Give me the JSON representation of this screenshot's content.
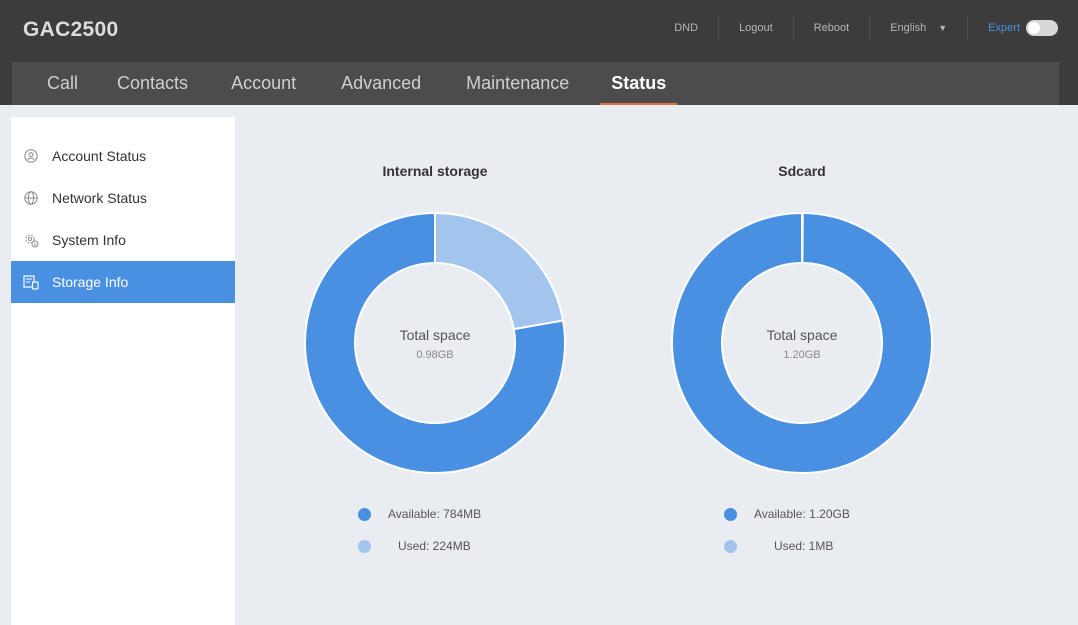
{
  "app": {
    "title": "GAC2500"
  },
  "header": {
    "links": [
      "DND",
      "Logout",
      "Reboot"
    ],
    "language": "English",
    "expert_label": "Expert"
  },
  "nav": {
    "tabs": [
      {
        "label": "Call"
      },
      {
        "label": "Contacts"
      },
      {
        "label": "Account"
      },
      {
        "label": "Advanced"
      },
      {
        "label": "Maintenance"
      },
      {
        "label": "Status",
        "active": true
      }
    ]
  },
  "sidebar": {
    "items": [
      {
        "label": "Account Status",
        "icon": "user-circle-icon"
      },
      {
        "label": "Network Status",
        "icon": "globe-icon"
      },
      {
        "label": "System Info",
        "icon": "gear-info-icon"
      },
      {
        "label": "Storage Info",
        "icon": "storage-icon",
        "active": true
      }
    ]
  },
  "colors": {
    "accent": "#4a90e2",
    "available": "#4a90e2",
    "used": "#a3c4ec",
    "tab_underline": "#e8703a"
  },
  "chart_data": [
    {
      "type": "pie",
      "title": "Internal storage",
      "center_label": "Total space",
      "center_value": "0.98GB",
      "series": [
        {
          "name": "Available",
          "value": 784,
          "label": "Available: 784MB"
        },
        {
          "name": "Used",
          "value": 224,
          "label": "Used: 224MB"
        }
      ]
    },
    {
      "type": "pie",
      "title": "Sdcard",
      "center_label": "Total space",
      "center_value": "1.20GB",
      "series": [
        {
          "name": "Available",
          "value": 1228.8,
          "label": "Available: 1.20GB"
        },
        {
          "name": "Used",
          "value": 1,
          "label": "Used: 1MB"
        }
      ]
    }
  ]
}
